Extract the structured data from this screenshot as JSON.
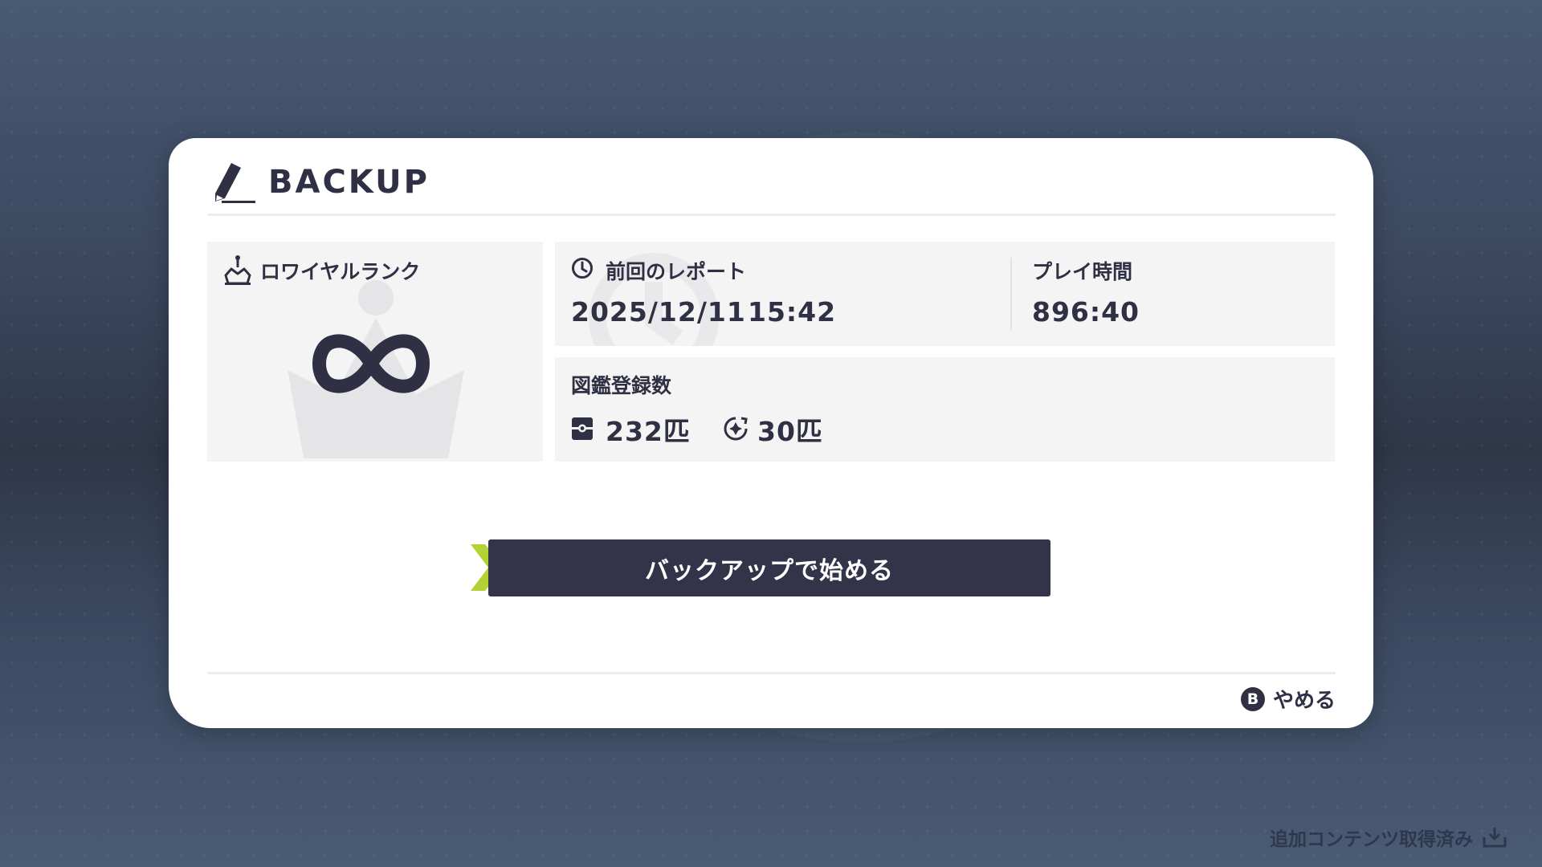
{
  "dialog": {
    "title": "BACKUP",
    "icon": "pen-icon"
  },
  "rank": {
    "label": "ロワイヤルランク",
    "icon": "crown-icon",
    "value_icon": "infinity-icon"
  },
  "report": {
    "label": "前回のレポート",
    "icon": "clock-icon",
    "date": "2025/12/11",
    "time": "15:42"
  },
  "playtime": {
    "label": "プレイ時間",
    "value": "896:40"
  },
  "dex": {
    "label": "図鑑登録数",
    "registered_icon": "pokedex-icon",
    "registered_count": "232匹",
    "mega_icon": "mega-evolution-icon",
    "mega_count": "30匹"
  },
  "actions": {
    "start_label": "バックアップで始める",
    "cancel_key": "B",
    "cancel_label": "やめる"
  },
  "status": {
    "dlc_text": "追加コンテンツ取得済み",
    "dlc_icon": "download-icon"
  },
  "colors": {
    "background": "#3b4860",
    "panel": "#f4f4f5",
    "text": "#2f3044",
    "button": "#33344a",
    "cursor_accent": "#b3d334"
  }
}
